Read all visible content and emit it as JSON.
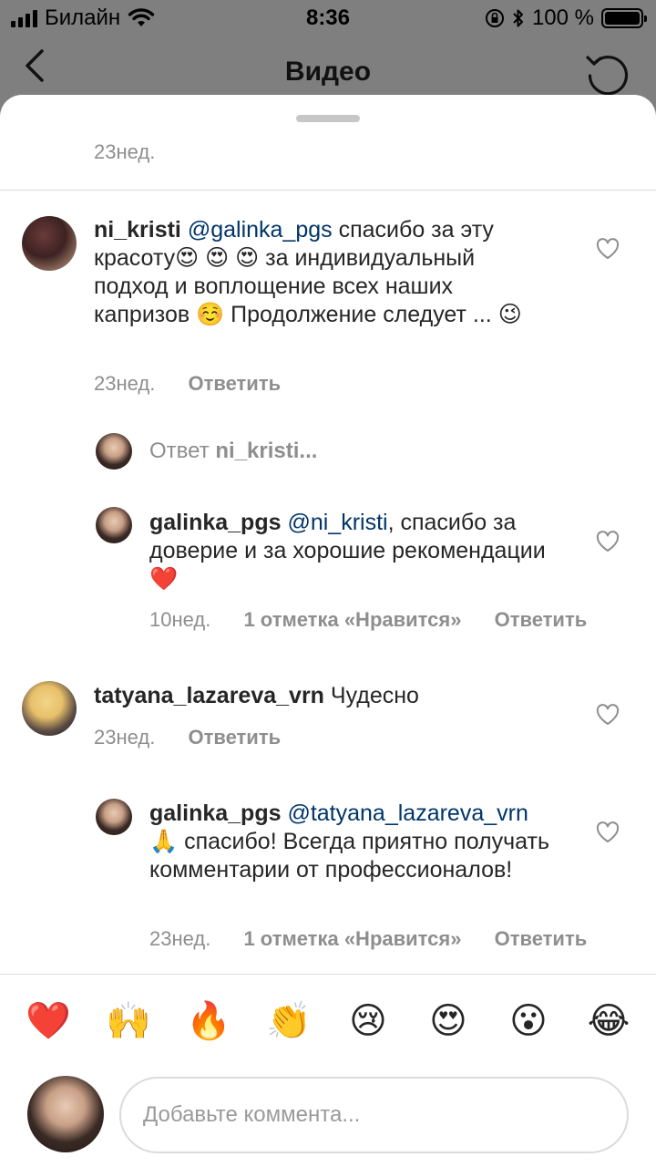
{
  "status_bar": {
    "carrier": "Билайн",
    "time": "8:36",
    "battery": "100 %"
  },
  "nav": {
    "title": "Видео"
  },
  "top_meta": {
    "time": "23нед."
  },
  "comments": [
    {
      "username": "ni_kristi",
      "mention": "@galinka_pgs",
      "text": "спасибо за эту красоту😍 😍 😍 за индивидуальный подход и воплощение всех наших капризов ☺️ Продолжение следует ... 😉",
      "time": "23нед.",
      "reply_label": "Ответить"
    },
    {
      "username": "galinka_pgs",
      "mention": "@ni_kristi",
      "text": ", спасибо за доверие и за хорошие рекомендации❤️",
      "time": "10нед.",
      "likes": "1 отметка «Нравится»",
      "reply_label": "Ответить"
    },
    {
      "username": "tatyana_lazareva_vrn",
      "text": "Чудесно",
      "time": "23нед.",
      "reply_label": "Ответить"
    },
    {
      "username": "galinka_pgs",
      "mention": "@tatyana_lazareva_vrn",
      "text": "🙏 спасибо! Всегда приятно получать комментарии от профессионалов!",
      "time": "23нед.",
      "likes": "1 отметка «Нравится»",
      "reply_label": "Ответить"
    }
  ],
  "reply_prompt": {
    "prefix": "Ответ",
    "username": "ni_kristi..."
  },
  "emoji_bar": [
    "❤️",
    "🙌",
    "🔥",
    "👏",
    "😢",
    "😍",
    "😮",
    "😂"
  ],
  "composer": {
    "placeholder": "Добавьте коммента..."
  },
  "colors": {
    "mention": "#003569",
    "secondary_text": "#8e8e8e",
    "divider": "#dbdbdb"
  },
  "icons": {
    "back": "chevron-left-icon",
    "refresh": "refresh-icon",
    "like": "heart-outline-icon"
  }
}
